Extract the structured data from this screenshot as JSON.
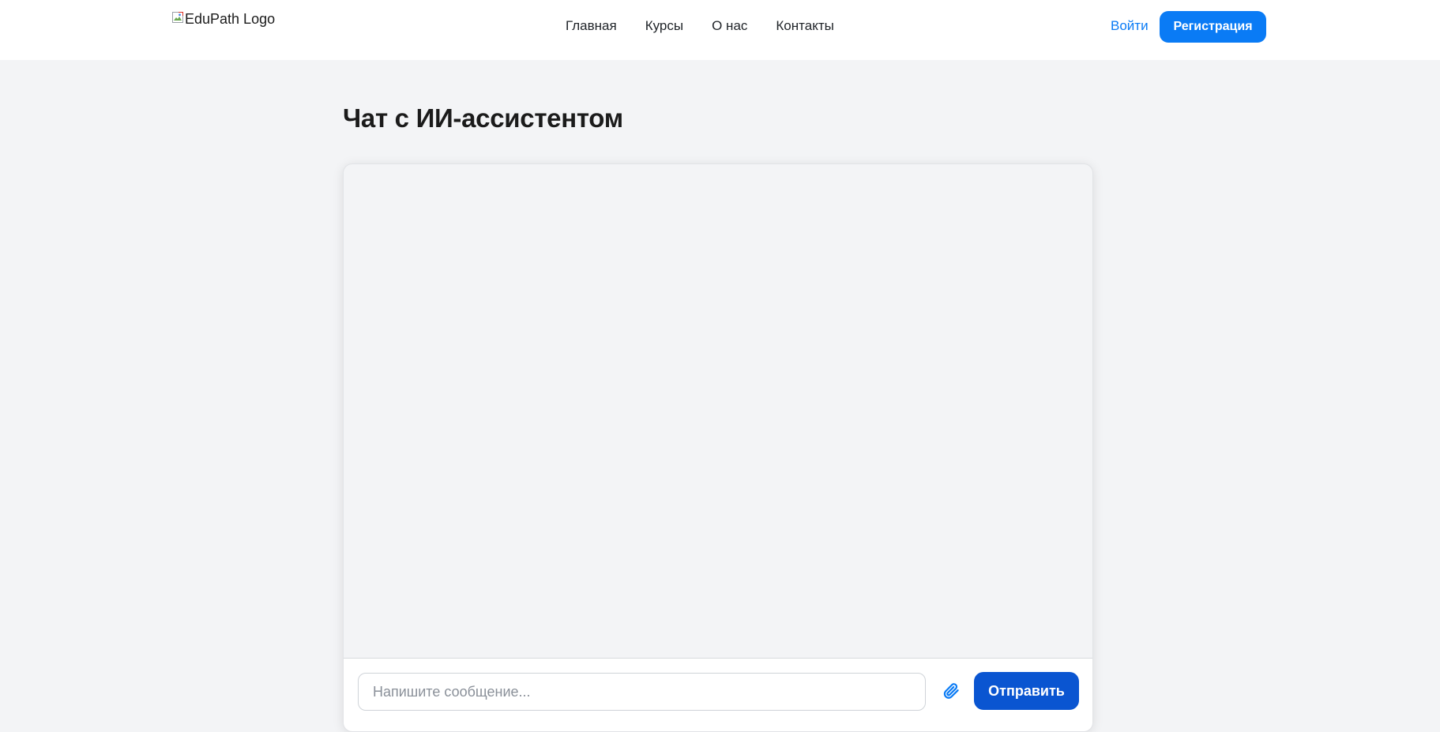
{
  "header": {
    "logo_alt": "EduPath Logo",
    "nav": [
      {
        "label": "Главная"
      },
      {
        "label": "Курсы"
      },
      {
        "label": "О нас"
      },
      {
        "label": "Контакты"
      }
    ],
    "login_label": "Войти",
    "register_label": "Регистрация"
  },
  "main": {
    "title": "Чат с ИИ-ассистентом"
  },
  "chat": {
    "messages": [],
    "input": {
      "value": "",
      "placeholder": "Напишите сообщение..."
    },
    "attach_icon": "paperclip-icon",
    "send_label": "Отправить"
  },
  "colors": {
    "accent": "#0a7bf5",
    "send_button": "#0a55d1",
    "page_background": "#f3f4f6",
    "header_background": "#ffffff"
  }
}
